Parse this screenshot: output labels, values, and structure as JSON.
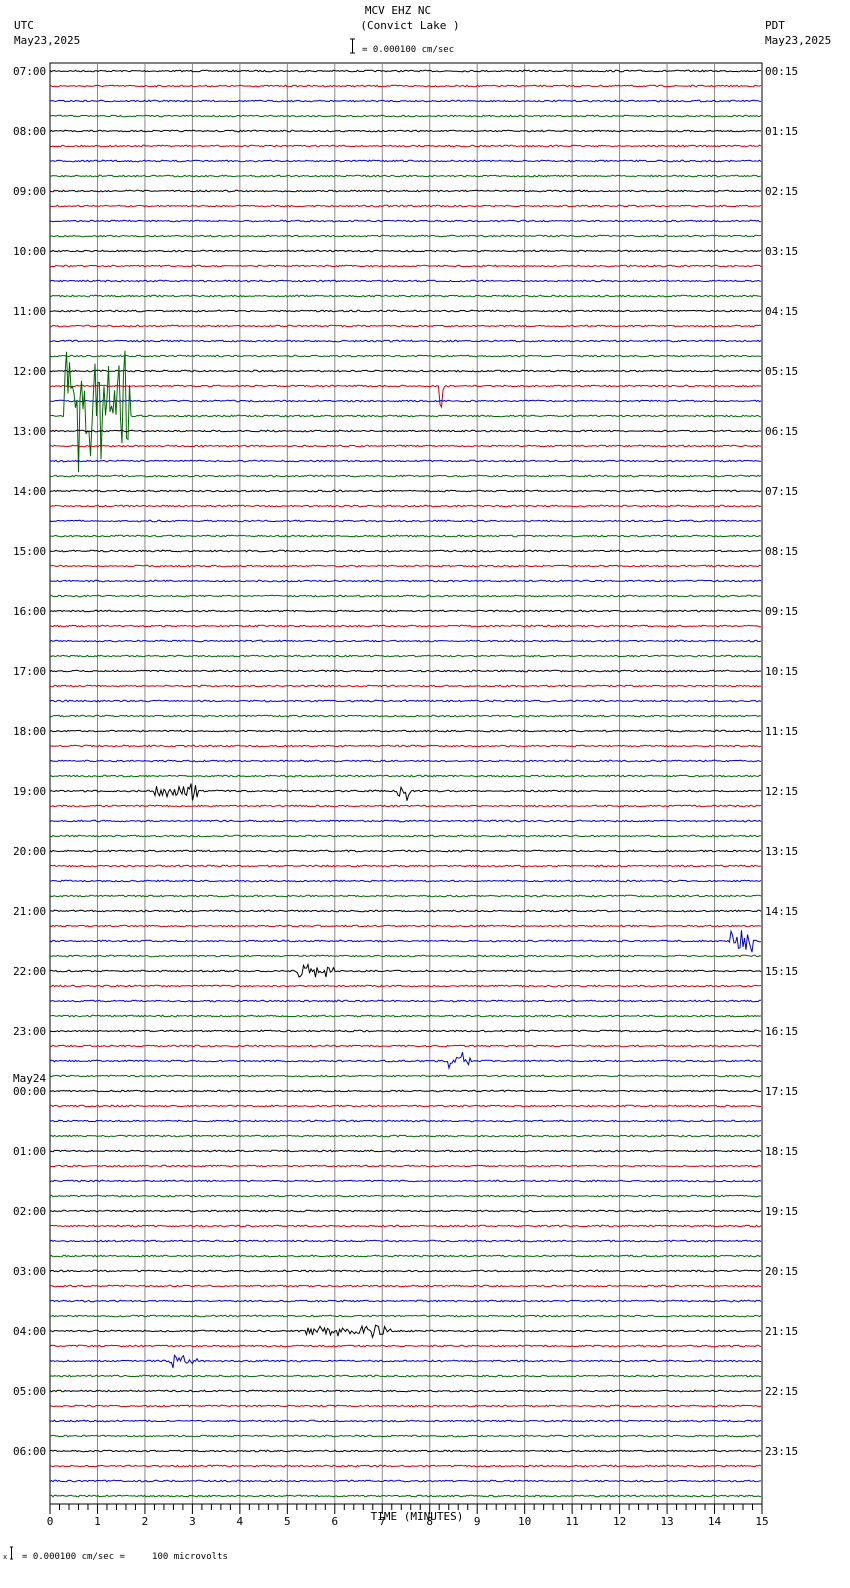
{
  "header": {
    "station": "MCV EHZ NC",
    "location": "(Convict Lake )",
    "left_tz": "UTC",
    "left_date": "May23,2025",
    "right_tz": "PDT",
    "right_date": "May23,2025",
    "scale": "= 0.000100 cm/sec"
  },
  "footer": {
    "scale_note": "= 0.000100 cm/sec =     100 microvolts"
  },
  "chart_data": {
    "type": "line",
    "title": "MCV EHZ NC (Convict Lake )",
    "xlabel": "TIME (MINUTES)",
    "xlim": [
      0,
      15
    ],
    "x_ticks": [
      "0",
      "1",
      "2",
      "3",
      "4",
      "5",
      "6",
      "7",
      "8",
      "9",
      "10",
      "11",
      "12",
      "13",
      "14",
      "15"
    ],
    "trace_count": 96,
    "trace_minutes": 15,
    "colors": [
      "#000000",
      "#cc0000",
      "#0000cc",
      "#006600"
    ],
    "left_labels": [
      "07:00",
      "08:00",
      "09:00",
      "10:00",
      "11:00",
      "12:00",
      "13:00",
      "14:00",
      "15:00",
      "16:00",
      "17:00",
      "18:00",
      "19:00",
      "20:00",
      "21:00",
      "22:00",
      "23:00",
      "00:00",
      "01:00",
      "02:00",
      "03:00",
      "04:00",
      "05:00",
      "06:00"
    ],
    "left_date_change": {
      "label": "May24",
      "before_hour_index": 17
    },
    "right_labels": [
      "00:15",
      "01:15",
      "02:15",
      "03:15",
      "04:15",
      "05:15",
      "06:15",
      "07:15",
      "08:15",
      "09:15",
      "10:15",
      "11:15",
      "12:15",
      "13:15",
      "14:15",
      "15:15",
      "16:15",
      "17:15",
      "18:15",
      "19:15",
      "20:15",
      "21:15",
      "22:15",
      "23:15"
    ],
    "events": [
      {
        "trace": 23,
        "start": 0.3,
        "end": 1.7,
        "amp": 8
      },
      {
        "trace": 21,
        "start": 8.2,
        "end": 8.3,
        "amp": 4
      },
      {
        "trace": 48,
        "start": 2.2,
        "end": 3.1,
        "amp": 1
      },
      {
        "trace": 48,
        "start": 7.3,
        "end": 7.6,
        "amp": 1.2
      },
      {
        "trace": 58,
        "start": 14.3,
        "end": 14.8,
        "amp": 1.2
      },
      {
        "trace": 60,
        "start": 5.2,
        "end": 6.0,
        "amp": 0.7
      },
      {
        "trace": 66,
        "start": 8.4,
        "end": 8.9,
        "amp": 0.8
      },
      {
        "trace": 84,
        "start": 5.4,
        "end": 7.2,
        "amp": 0.6
      },
      {
        "trace": 86,
        "start": 2.5,
        "end": 3.1,
        "amp": 0.7
      }
    ]
  }
}
